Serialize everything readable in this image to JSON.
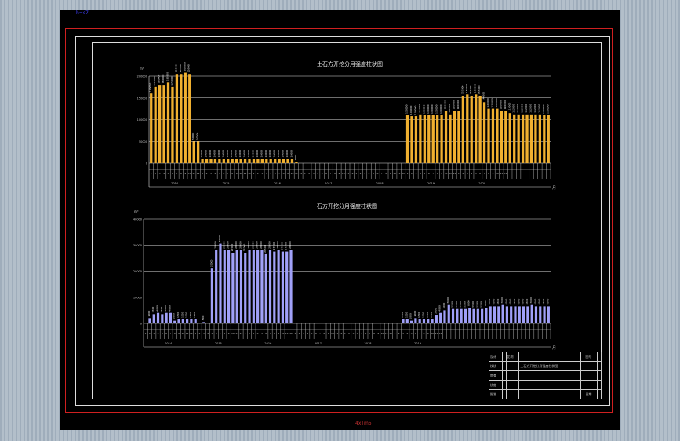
{
  "callouts": {
    "top": "h=c7",
    "bottom": "4xTm5"
  },
  "chart_data": [
    {
      "type": "bar",
      "title": "土石方开挖分月强度柱状图",
      "unit": "m³",
      "color": "#f0b030",
      "ylim": [
        0,
        200000
      ],
      "yticks": [
        "200000",
        "150000",
        "100000",
        "50000",
        "0"
      ],
      "xlabel": "月",
      "years": [
        "2014",
        "2015",
        "2016",
        "2017",
        "2018",
        "2019",
        "2020"
      ],
      "months": [
        "1",
        "2",
        "3",
        "4",
        "5",
        "6",
        "7",
        "8",
        "9",
        "10",
        "11",
        "12",
        "1",
        "2",
        "3",
        "4",
        "5",
        "6",
        "7",
        "8",
        "9",
        "10",
        "11",
        "12",
        "1",
        "2",
        "3",
        "4",
        "5",
        "6",
        "7",
        "8",
        "9",
        "10",
        "11",
        "12",
        "1",
        "2",
        "3",
        "4",
        "5",
        "6",
        "7",
        "8",
        "9",
        "10",
        "11",
        "12",
        "1",
        "2",
        "3",
        "4",
        "5",
        "6",
        "7",
        "8",
        "9",
        "10",
        "11",
        "12",
        "1",
        "2",
        "3",
        "4",
        "5",
        "6",
        "7",
        "8",
        "9",
        "10",
        "11",
        "12",
        "1",
        "2",
        "3",
        "4",
        "5",
        "6",
        "7",
        "8",
        "9",
        "10",
        "11",
        "12"
      ],
      "values": [
        160000,
        175000,
        180000,
        180000,
        185000,
        175000,
        205000,
        205000,
        208000,
        205000,
        50000,
        50000,
        10000,
        10000,
        10000,
        10000,
        10000,
        10000,
        10000,
        10000,
        10000,
        10000,
        10000,
        10000,
        10000,
        10000,
        10000,
        10000,
        10000,
        10000,
        10000,
        10000,
        10000,
        10000,
        3000,
        0,
        0,
        0,
        0,
        0,
        0,
        0,
        0,
        0,
        0,
        0,
        0,
        0,
        0,
        0,
        0,
        0,
        0,
        0,
        0,
        0,
        0,
        0,
        0,
        0,
        110000,
        108000,
        108000,
        112000,
        110000,
        110000,
        110000,
        110000,
        110000,
        120000,
        112000,
        120000,
        120000,
        155000,
        158000,
        155000,
        158000,
        155000,
        140000,
        125000,
        125000,
        125000,
        120000,
        120000,
        115000,
        112000,
        112000,
        112000,
        112000,
        112000,
        112000,
        112000,
        110000,
        110000
      ]
    },
    {
      "type": "bar",
      "title": "石方开挖分月强度柱状图",
      "unit": "m³",
      "color": "#a0a0f8",
      "ylim": [
        0,
        40000
      ],
      "yticks": [
        "40000",
        "30000",
        "20000",
        "10000",
        "0"
      ],
      "xlabel": "月",
      "years": [
        "2014",
        "2015",
        "2016",
        "2017",
        "2018",
        "2019"
      ],
      "months": [
        "1",
        "2",
        "3",
        "4",
        "5",
        "6",
        "7",
        "8",
        "9",
        "10",
        "11",
        "12",
        "1",
        "2",
        "3",
        "4",
        "5",
        "6",
        "7",
        "8",
        "9",
        "10",
        "11",
        "12",
        "1",
        "2",
        "3",
        "4",
        "5",
        "6",
        "7",
        "8",
        "9",
        "10",
        "11",
        "12",
        "1",
        "2",
        "3",
        "4",
        "5",
        "6",
        "7",
        "8",
        "9",
        "10",
        "11",
        "12",
        "1",
        "2",
        "3",
        "4",
        "5",
        "6",
        "7",
        "8",
        "9",
        "10",
        "11",
        "12",
        "1",
        "2",
        "3",
        "4",
        "5",
        "6",
        "7",
        "8",
        "9",
        "10",
        "11",
        "12"
      ],
      "values": [
        0,
        2000,
        3500,
        4000,
        3500,
        4000,
        4000,
        1000,
        1500,
        1500,
        1500,
        1500,
        1500,
        0,
        500,
        0,
        21000,
        28000,
        30500,
        28000,
        28000,
        27000,
        28000,
        28000,
        27000,
        28000,
        28000,
        28000,
        28000,
        26500,
        28000,
        27500,
        28000,
        27500,
        27500,
        28000,
        0,
        0,
        0,
        0,
        0,
        0,
        0,
        0,
        0,
        0,
        0,
        0,
        0,
        0,
        0,
        0,
        0,
        0,
        0,
        0,
        0,
        0,
        0,
        0,
        0,
        0,
        1500,
        1500,
        1000,
        2000,
        1500,
        1500,
        1500,
        1500,
        3000,
        4000,
        5000,
        7000,
        5500,
        5500,
        5500,
        5500,
        6000,
        5500,
        5500,
        5500,
        6000,
        6500,
        6500,
        6500,
        7000,
        6500,
        6500,
        6500,
        6500,
        6500,
        6500,
        7000,
        6500,
        6500,
        6500,
        6500
      ]
    }
  ],
  "title_block": {
    "rows": [
      [
        "设计",
        "",
        "比例",
        "",
        "",
        "图号",
        ""
      ],
      [
        "校核",
        "",
        "",
        "土石方开挖分月强度柱状图",
        "",
        "",
        ""
      ],
      [
        "审查",
        "",
        "",
        "",
        "",
        "",
        ""
      ],
      [
        "核定",
        "",
        "",
        "",
        "",
        "",
        ""
      ],
      [
        "批准",
        "",
        "",
        "",
        "",
        "日期",
        ""
      ]
    ]
  }
}
